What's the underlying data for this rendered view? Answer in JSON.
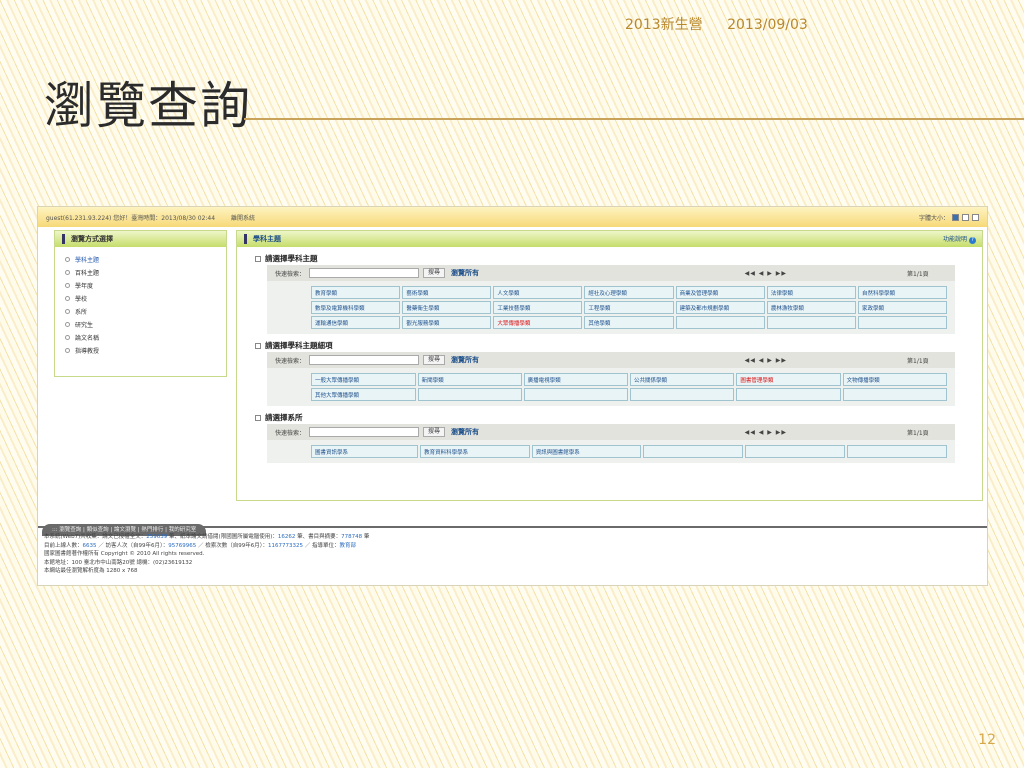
{
  "slide": {
    "header_left": "2013新生營",
    "header_date": "2013/09/03",
    "title": "瀏覽查詢",
    "page_number": "12"
  },
  "screenshot": {
    "topbar": {
      "session": "guest(61.231.93.224) 您好！臺灣時間：2013/08/30 02:44",
      "logout": "離開系統",
      "font_size_label": "字體大小："
    },
    "left_panel": {
      "title": "瀏覽方式選擇",
      "items": [
        "學科主題",
        "百科主題",
        "學年度",
        "學校",
        "系所",
        "研究生",
        "論文名稱",
        "指導教授"
      ]
    },
    "main": {
      "title": "學科主題",
      "help": "功能說明",
      "quick_search_label": "快速檢索：",
      "search_button": "搜尋",
      "browse_all": "瀏覽所有",
      "pager": "◀◀ ◀ ▶ ▶▶",
      "page_info": "第1/1頁",
      "sections": [
        {
          "title": "請選擇學科主題",
          "rows": [
            [
              "教育學類",
              "藝術學類",
              "人文學類",
              "經社及心理學類",
              "商業及管理學類",
              "法律學類",
              "自然科學學類"
            ],
            [
              "數學及電算機科學類",
              "醫藥衛生學類",
              "工業技藝學類",
              "工程學類",
              "建築及都市規劃學類",
              "農林漁牧學類",
              "家政學類"
            ],
            [
              "運輸通信學類",
              "觀光服務學類",
              "大眾傳播學類",
              "其他學類",
              "",
              "",
              ""
            ]
          ]
        },
        {
          "title": "請選擇學科主題細項",
          "rows": [
            [
              "一般大眾傳播學類",
              "新聞學類",
              "廣播電視學類",
              "公共關係學類",
              "圖書管理學類",
              "文物傳播學類"
            ],
            [
              "其他大眾傳播學類",
              "",
              "",
              "",
              "",
              ""
            ]
          ]
        },
        {
          "title": "請選擇系所",
          "rows": [
            [
              "圖書資訊學系",
              "教育資料科學學系",
              "資訊與圖書館學系",
              "",
              "",
              ""
            ]
          ]
        }
      ]
    },
    "footer_tabs": "::: 瀏覽查詢 | 類似查詢 | 論文瀏覽 | 熱門排行 | 我的研究室",
    "footer": {
      "line1_a": "本系統(Web7)共收集：論文已授權全文：",
      "fulltext_count": "259639",
      "line1_b": " 筆、紙本論文請借閱(限國圖所屬電腦使用)：",
      "paper_count": "16262",
      "line1_c": " 筆、書目與摘要：",
      "abstract_count": "778748",
      "line1_d": " 筆",
      "line2_a": "目前上線人數：",
      "online_count": "6635",
      "line2_b": " ／ 訪客人次（自99年6月）：",
      "visitor_count": "95769965",
      "line2_c": " ／ 檢索次數（自99年6月）：",
      "search_count": "1167773325",
      "line2_d": " ／ 指導單位：",
      "supervisor": "教育部",
      "line3": "國家圖書館著作權所有 Copyright © 2010 All rights reserved.",
      "line4": "本館地址：100 臺北市中山南路20號 總機：(02)23619132",
      "line5": "本網站最佳瀏覽解析度為 1280 x 768"
    }
  }
}
